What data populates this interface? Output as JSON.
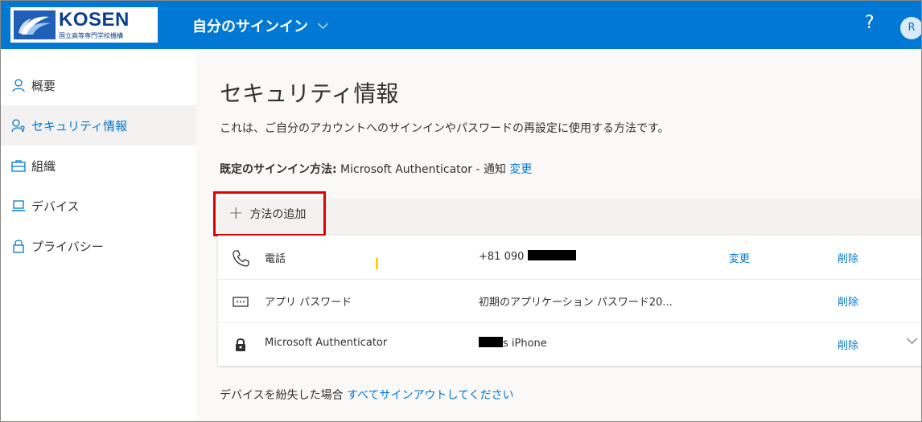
{
  "header": {
    "logo_text": "KOSEN",
    "logo_subtext": "国立高等専門学校機構",
    "app_title": "自分のサインイン",
    "help_icon": "?",
    "avatar_initial": "R",
    "brand_color": "#0078d4"
  },
  "sidebar": {
    "items": [
      {
        "label": "概要",
        "icon": "person-icon",
        "active": false
      },
      {
        "label": "セキュリティ情報",
        "icon": "security-info-icon",
        "active": true
      },
      {
        "label": "組織",
        "icon": "briefcase-icon",
        "active": false
      },
      {
        "label": "デバイス",
        "icon": "laptop-icon",
        "active": false
      },
      {
        "label": "プライバシー",
        "icon": "lock-icon",
        "active": false
      }
    ]
  },
  "main": {
    "title": "セキュリティ情報",
    "description": "これは、ご自分のアカウントへのサインインやパスワードの再設定に使用する方法です。",
    "default_method": {
      "label": "既定のサインイン方法:",
      "value": " Microsoft Authenticator - 通知 ",
      "change_link": "変更"
    },
    "add_method_label": "方法の追加",
    "methods": [
      {
        "icon": "phone-icon",
        "name": "電話",
        "detail": "+81 090",
        "change": "変更",
        "delete": "削除"
      },
      {
        "icon": "app-password-icon",
        "name": "アプリ パスワード",
        "detail": "初期のアプリケーション パスワード20...",
        "change": "",
        "delete": "削除"
      },
      {
        "icon": "authenticator-lock-icon",
        "name": "Microsoft Authenticator",
        "detail": "s iPhone",
        "change": "",
        "delete": "削除"
      }
    ],
    "lost_device": {
      "text": "デバイスを紛失した場合 ",
      "link": "すべてサインアウトしてください"
    }
  }
}
